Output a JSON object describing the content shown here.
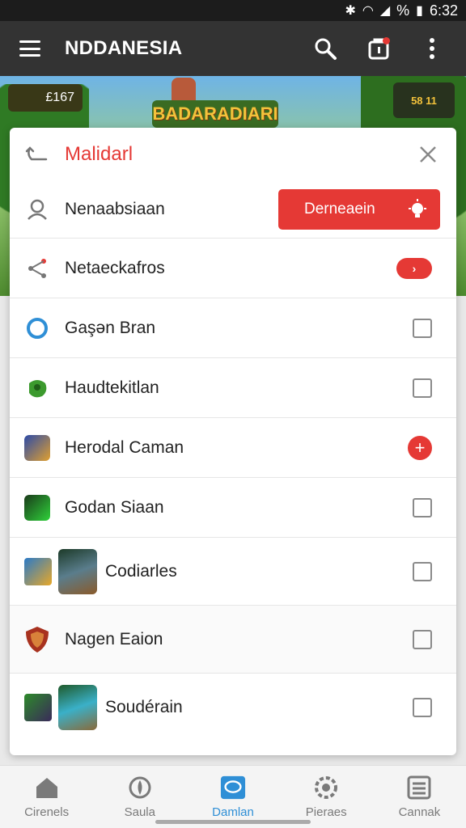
{
  "status_bar": {
    "battery_text": "%",
    "time": "6:32"
  },
  "app_bar": {
    "title": "NDDANESIA"
  },
  "banner": {
    "title": "BADARADIARI",
    "score": "£167",
    "hud": "58 11"
  },
  "sheet": {
    "title": "Malidarl",
    "rows": [
      {
        "label": "Nenaabsiaan",
        "button_label": "Derneaein"
      },
      {
        "label": "Netaeckafros"
      },
      {
        "label": "Gaşən Bran"
      },
      {
        "label": "Haudtekitlan"
      },
      {
        "label": "Herodal Caman"
      },
      {
        "label": "Godan Siaan"
      },
      {
        "label": "Codiarles"
      },
      {
        "label": "Nagen Eaion"
      },
      {
        "label": "Soudérain"
      }
    ]
  },
  "bottom_nav": [
    {
      "label": "Cirenels",
      "icon": "home-icon"
    },
    {
      "label": "Saula",
      "icon": "shield-icon"
    },
    {
      "label": "Damlan",
      "icon": "chat-icon",
      "active": true
    },
    {
      "label": "Pieraes",
      "icon": "settings-icon"
    },
    {
      "label": "Cannak",
      "icon": "list-icon"
    }
  ],
  "colors": {
    "accent": "#e53935",
    "appbar": "#333333",
    "active_nav": "#2f8fd6"
  }
}
